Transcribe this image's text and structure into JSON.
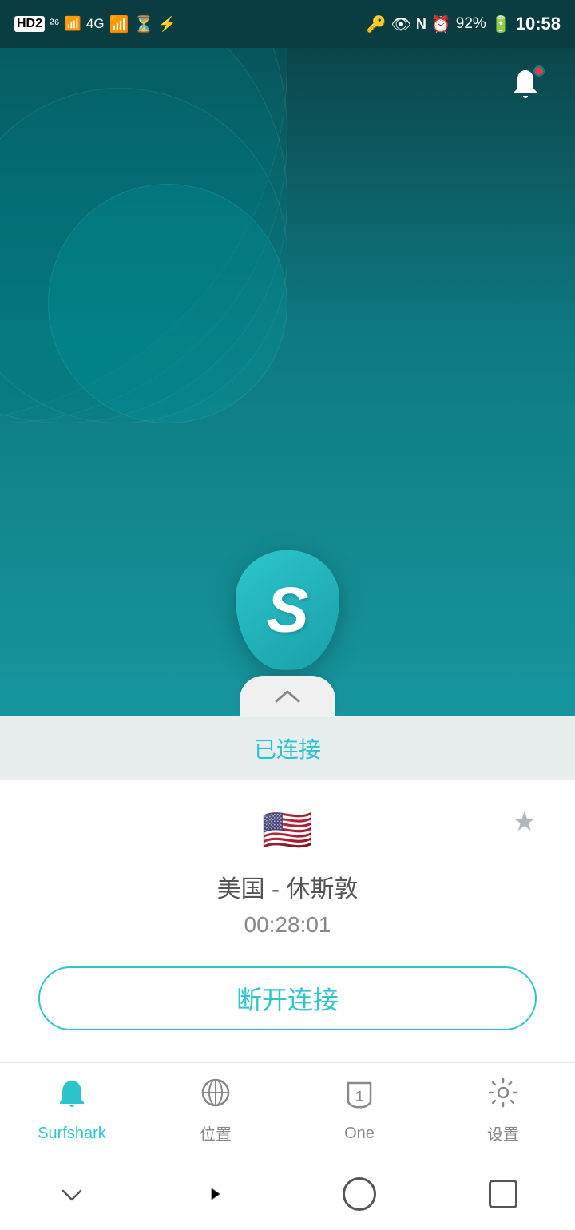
{
  "statusBar": {
    "leftIcons": "HD2  26  4G  46  ☁  ✕  ✦",
    "rightIcons": "🔑  👁  N  ⏰  92%",
    "time": "10:58",
    "battery": "92%"
  },
  "notification": {
    "hasDot": true
  },
  "vpn": {
    "connectedLabel": "已连接",
    "location": "美国 - 休斯敦",
    "timer": "00:28:01",
    "disconnectLabel": "断开连接",
    "flag": "🇺🇸"
  },
  "nav": {
    "items": [
      {
        "label": "Surfshark",
        "active": true
      },
      {
        "label": "位置",
        "active": false
      },
      {
        "label": "One",
        "active": false
      },
      {
        "label": "设置",
        "active": false
      }
    ]
  },
  "systemNav": {
    "chevron": "⌄",
    "back": "‹",
    "home": "",
    "recents": ""
  }
}
